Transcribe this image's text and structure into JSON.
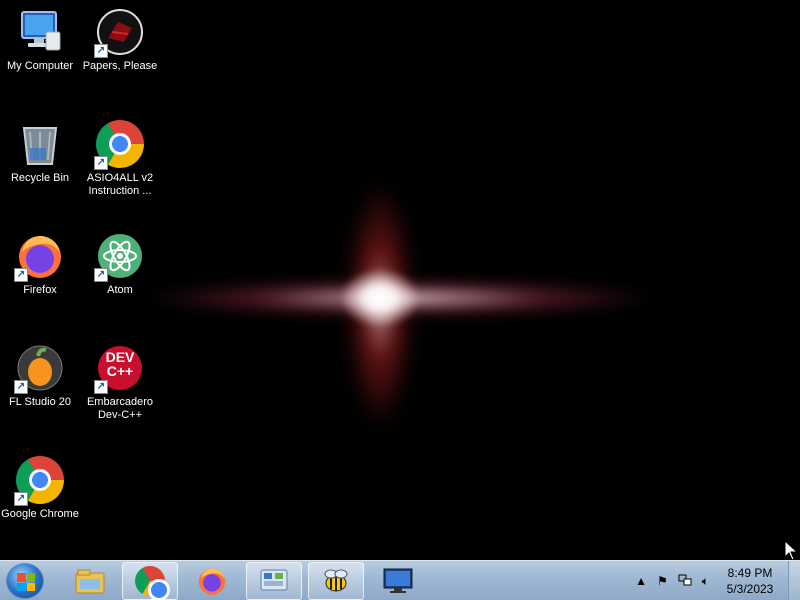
{
  "desktop_icons": [
    {
      "label": "My Computer",
      "icon": "computer-icon"
    },
    {
      "label": "Papers, Please",
      "icon": "papers-please-icon"
    },
    {
      "label": "Recycle Bin",
      "icon": "recycle-bin-icon"
    },
    {
      "label": "ASIO4ALL v2\nInstruction ...",
      "icon": "chrome-icon"
    },
    {
      "label": "Firefox",
      "icon": "firefox-icon"
    },
    {
      "label": "Atom",
      "icon": "atom-icon"
    },
    {
      "label": "FL Studio 20",
      "icon": "fl-studio-icon"
    },
    {
      "label": "Embarcadero\nDev-C++",
      "icon": "devcpp-icon"
    },
    {
      "label": "Google Chrome",
      "icon": "chrome-icon"
    }
  ],
  "devcpp_text": "DEV\nC++",
  "taskbar": {
    "start_icon": "windows-start-icon",
    "pinned": [
      "explorer-icon",
      "chrome-icon",
      "firefox-icon",
      "control-panel-icon",
      "bee-icon",
      "monitor-icon"
    ],
    "tray_icons": [
      "chevron-up-icon",
      "flag-icon",
      "network-icon",
      "volume-icon"
    ],
    "time": "8:49 PM",
    "date": "5/3/2023"
  },
  "colors": {
    "taskbar": "#9fb8d3",
    "desktop": "#000000"
  }
}
